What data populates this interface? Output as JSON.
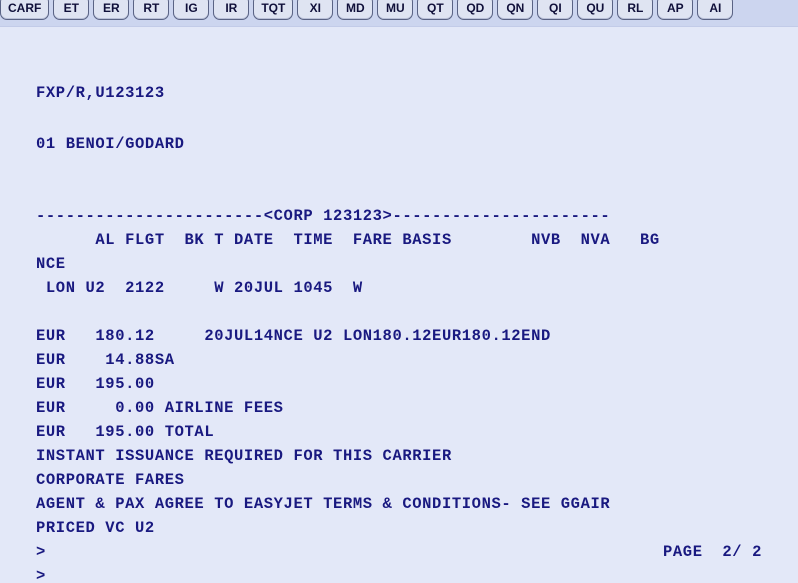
{
  "window": {
    "app_name": "amadeus-gds-terminal",
    "background_color": "#e3e8f8",
    "text_color": "#191980",
    "toolbar_color": "#ccd5ef"
  },
  "toolbar": {
    "buttons": [
      {
        "label": "CARF",
        "name": "toolbar-button-carf"
      },
      {
        "label": "ET",
        "name": "toolbar-button-et"
      },
      {
        "label": "ER",
        "name": "toolbar-button-er"
      },
      {
        "label": "RT",
        "name": "toolbar-button-rt"
      },
      {
        "label": "IG",
        "name": "toolbar-button-ig"
      },
      {
        "label": "IR",
        "name": "toolbar-button-ir"
      },
      {
        "label": "TQT",
        "name": "toolbar-button-tqt"
      },
      {
        "label": "XI",
        "name": "toolbar-button-xi"
      },
      {
        "label": "MD",
        "name": "toolbar-button-md"
      },
      {
        "label": "MU",
        "name": "toolbar-button-mu"
      },
      {
        "label": "QT",
        "name": "toolbar-button-qt"
      },
      {
        "label": "QD",
        "name": "toolbar-button-qd"
      },
      {
        "label": "QN",
        "name": "toolbar-button-qn"
      },
      {
        "label": "QI",
        "name": "toolbar-button-qi"
      },
      {
        "label": "QU",
        "name": "toolbar-button-qu"
      },
      {
        "label": "RL",
        "name": "toolbar-button-rl"
      },
      {
        "label": "AP",
        "name": "toolbar-button-ap"
      },
      {
        "label": "AI",
        "name": "toolbar-button-ai"
      }
    ]
  },
  "terminal": {
    "command_entry": "FXP/R,U123123",
    "passenger_line": "01 BENOI/GODARD",
    "separator_line": "-----------------------<CORP 123123>----------------------",
    "column_headers": "      AL FLGT  BK T DATE  TIME  FARE BASIS        NVB  NVA   BG",
    "origin_city": "NCE",
    "segment_line": " LON U2  2122     W 20JUL 1045  W",
    "fare_lines": [
      "EUR   180.12     20JUL14NCE U2 LON180.12EUR180.12END",
      "EUR    14.88SA",
      "EUR   195.00",
      "EUR     0.00 AIRLINE FEES",
      "EUR   195.00 TOTAL"
    ],
    "notice_lines": [
      "INSTANT ISSUANCE REQUIRED FOR THIS CARRIER",
      "CORPORATE FARES",
      "AGENT & PAX AGREE TO EASYJET TERMS & CONDITIONS- SEE GGAIR",
      "PRICED VC U2"
    ],
    "prompt_first": ">",
    "prompt_second": ">",
    "page_indicator": "PAGE  2/ 2"
  }
}
